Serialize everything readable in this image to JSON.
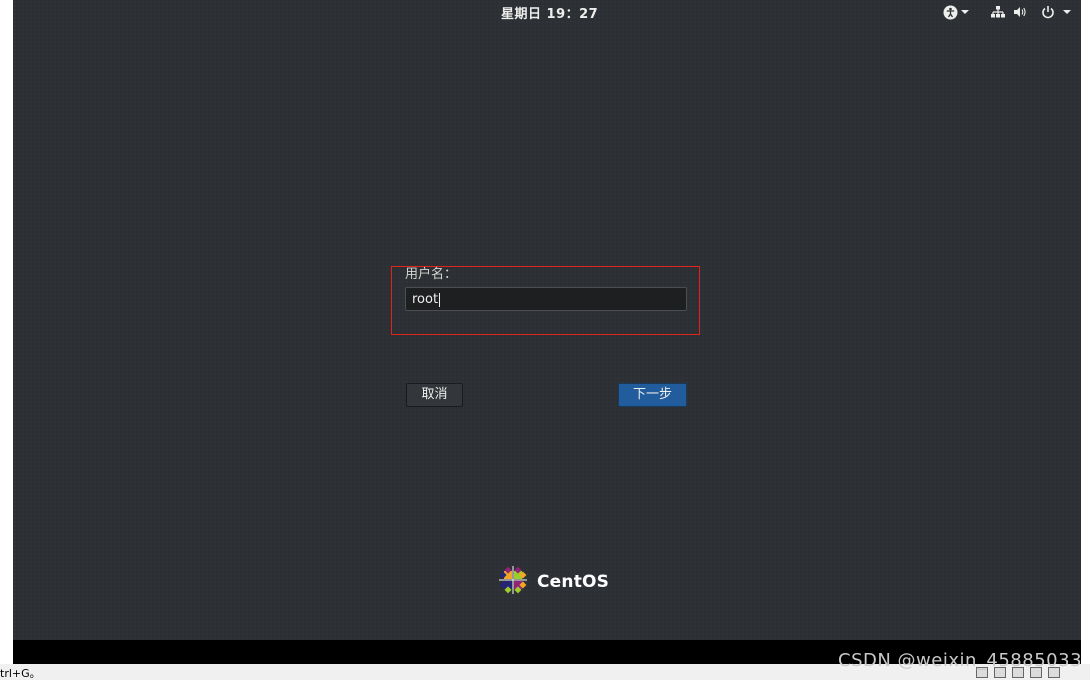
{
  "topbar": {
    "clock": "星期日 19：27",
    "icons": [
      "accessibility-icon",
      "network-icon",
      "volume-icon",
      "power-icon"
    ]
  },
  "login": {
    "username_label": "用户名：",
    "username_value": "root",
    "cancel_label": "取消",
    "next_label": "下一步"
  },
  "brand": {
    "name": "CentOS"
  },
  "host_statusbar": {
    "hint": "trl+G。"
  },
  "watermark": "CSDN @weixin_45885033",
  "colors": {
    "background": "#2c2f33",
    "accent_button": "#215d9c",
    "highlight_box": "#e2231a"
  }
}
